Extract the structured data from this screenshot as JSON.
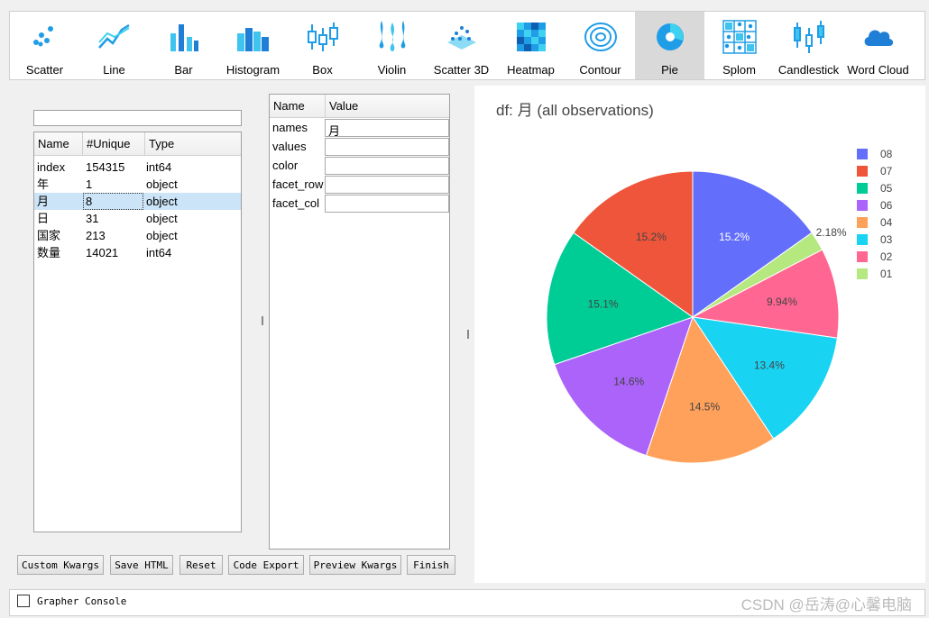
{
  "toolbar": {
    "items": [
      {
        "label": "Scatter",
        "icon": "scatter-icon"
      },
      {
        "label": "Line",
        "icon": "line-icon"
      },
      {
        "label": "Bar",
        "icon": "bar-icon"
      },
      {
        "label": "Histogram",
        "icon": "histogram-icon"
      },
      {
        "label": "Box",
        "icon": "box-icon"
      },
      {
        "label": "Violin",
        "icon": "violin-icon"
      },
      {
        "label": "Scatter 3D",
        "icon": "scatter-3d-icon"
      },
      {
        "label": "Heatmap",
        "icon": "heatmap-icon"
      },
      {
        "label": "Contour",
        "icon": "contour-icon"
      },
      {
        "label": "Pie",
        "icon": "pie-icon",
        "active": true
      },
      {
        "label": "Splom",
        "icon": "splom-icon"
      },
      {
        "label": "Candlestick",
        "icon": "candlestick-icon"
      },
      {
        "label": "Word Cloud",
        "icon": "cloud-icon"
      }
    ]
  },
  "columns": {
    "filter_value": "",
    "headers": [
      "Name",
      "#Unique",
      "Type"
    ],
    "rows": [
      {
        "name": "index",
        "unique": "154315",
        "type": "int64"
      },
      {
        "name": "年",
        "unique": "1",
        "type": "object"
      },
      {
        "name": "月",
        "unique": "8",
        "type": "object",
        "selected": true
      },
      {
        "name": "日",
        "unique": "31",
        "type": "object"
      },
      {
        "name": "国家",
        "unique": "213",
        "type": "object"
      },
      {
        "name": "数量",
        "unique": "14021",
        "type": "int64"
      }
    ]
  },
  "args": {
    "headers": [
      "Name",
      "Value"
    ],
    "rows": [
      {
        "name": "names",
        "value": "月"
      },
      {
        "name": "values",
        "value": ""
      },
      {
        "name": "color",
        "value": ""
      },
      {
        "name": "facet_row",
        "value": ""
      },
      {
        "name": "facet_col",
        "value": ""
      }
    ]
  },
  "buttons": {
    "custom_kwargs": "Custom Kwargs",
    "save_html": "Save HTML",
    "reset": "Reset",
    "code_export": "Code Export",
    "preview_kwargs": "Preview Kwargs",
    "finish": "Finish"
  },
  "console": {
    "label": "Grapher Console",
    "watermark": "CSDN @岳涛@心馨电脑"
  },
  "chart_data": {
    "type": "pie",
    "title": "df: 月 (all observations)",
    "legend_position": "top-right",
    "slices": [
      {
        "label": "08",
        "value": 15.2,
        "text": "15.2%",
        "color": "#636efa"
      },
      {
        "label": "01",
        "value": 2.18,
        "text": "2.18%",
        "color": "#b6e880"
      },
      {
        "label": "02",
        "value": 9.94,
        "text": "9.94%",
        "color": "#ff6692"
      },
      {
        "label": "03",
        "value": 13.4,
        "text": "13.4%",
        "color": "#19d3f3"
      },
      {
        "label": "04",
        "value": 14.5,
        "text": "14.5%",
        "color": "#ffa15a"
      },
      {
        "label": "06",
        "value": 14.6,
        "text": "14.6%",
        "color": "#ab63fa"
      },
      {
        "label": "05",
        "value": 15.1,
        "text": "15.1%",
        "color": "#00cc96"
      },
      {
        "label": "07",
        "value": 15.2,
        "text": "15.2%",
        "color": "#ef553b"
      }
    ],
    "legend": [
      {
        "label": "08",
        "color": "#636efa"
      },
      {
        "label": "07",
        "color": "#ef553b"
      },
      {
        "label": "05",
        "color": "#00cc96"
      },
      {
        "label": "06",
        "color": "#ab63fa"
      },
      {
        "label": "04",
        "color": "#ffa15a"
      },
      {
        "label": "03",
        "color": "#19d3f3"
      },
      {
        "label": "02",
        "color": "#ff6692"
      },
      {
        "label": "01",
        "color": "#b6e880"
      }
    ]
  }
}
